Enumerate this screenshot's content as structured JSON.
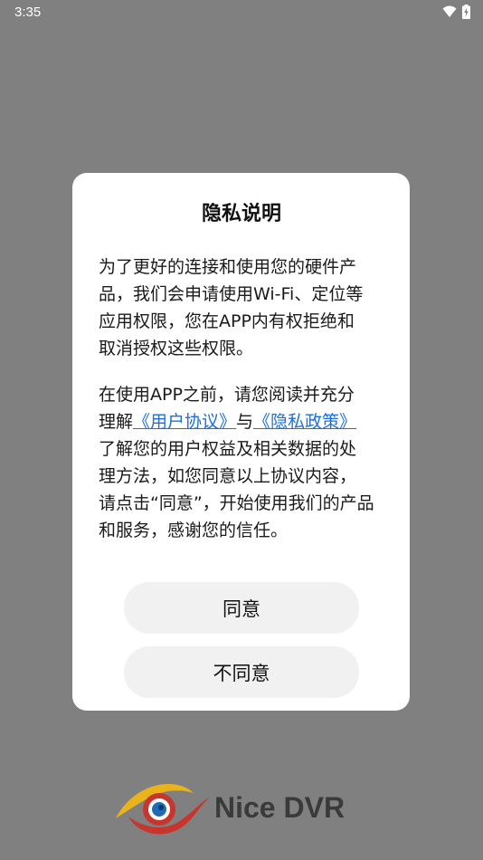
{
  "status_bar": {
    "time": "3:35",
    "icons": [
      "wifi-icon",
      "battery-charging-icon"
    ]
  },
  "dialog": {
    "title": "隐私说明",
    "paragraph1_lines": [
      "为了更好的连接和使用您的硬件产",
      "品，我们会申请使用Wi-Fi、定位等",
      "应用权限，您在APP内有权拒绝和",
      "取消授权这些权限。"
    ],
    "paragraph2": {
      "line1": "在使用APP之前，请您阅读并充分",
      "line2_prefix": "理解",
      "user_agreement_link": "《用户协议》",
      "line2_mid": "与",
      "privacy_policy_link": "《隐私政策》",
      "lines_rest": [
        "了解您的用户权益及相关数据的处",
        "理方法，如您同意以上协议内容，",
        "请点击“同意”，开始使用我们的产品",
        "和服务，感谢您的信任。"
      ]
    },
    "agree_button": "同意",
    "disagree_button": "不同意"
  },
  "brand": {
    "name": "Nice DVR",
    "logo_icon": "nice-dvr-logo-icon"
  },
  "colors": {
    "overlay": "#808080",
    "link": "#1e6fd9",
    "button_bg": "#f1f1f1",
    "logo_red": "#c8352c",
    "logo_yellow": "#e9b31c",
    "logo_blue": "#1f6bb5"
  }
}
